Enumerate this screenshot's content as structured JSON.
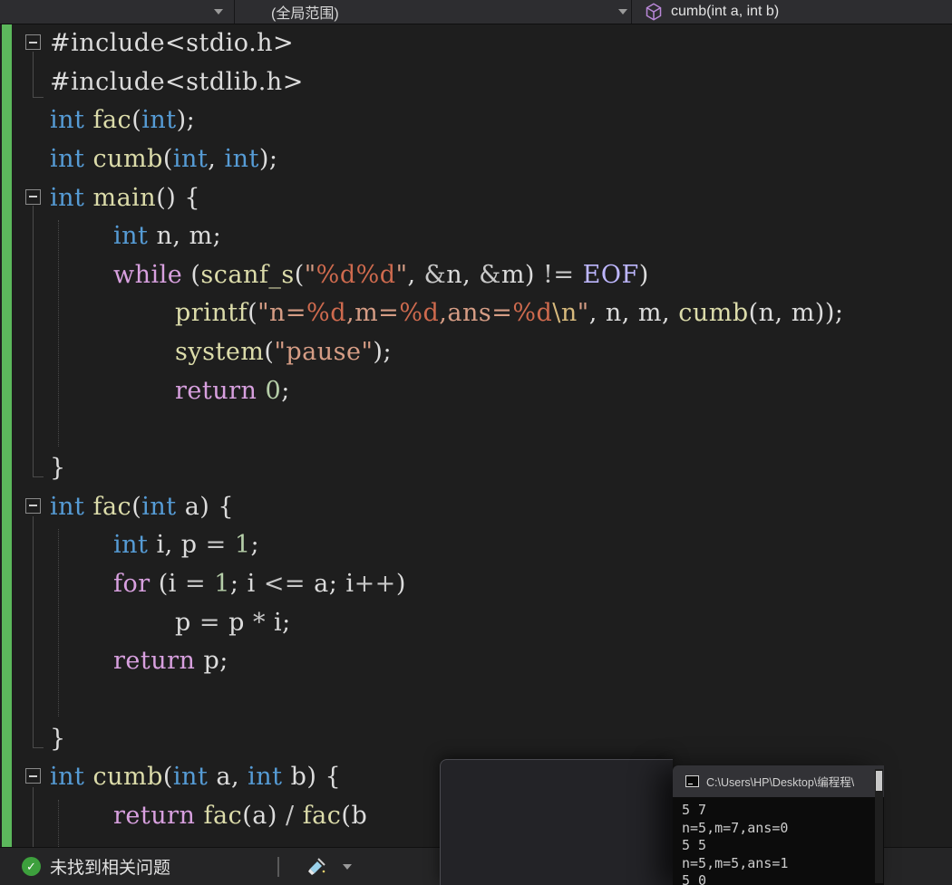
{
  "topbar": {
    "dropdown1": {
      "value": ""
    },
    "dropdown2": {
      "value": "(全局范围)"
    },
    "member": {
      "label": "cumb(int a, int b)",
      "icon": "cube-icon",
      "icon_color": "#B987D7"
    }
  },
  "editor": {
    "change_bar_color": "#5cb85c",
    "background": "#1e1e1e",
    "code_lines": [
      {
        "ind": 0,
        "fold": true,
        "segs": [
          {
            "t": "#include<stdio.h>",
            "c": "d"
          }
        ]
      },
      {
        "ind": 0,
        "fold": false,
        "segs": [
          {
            "t": "#include<stdlib.h>",
            "c": "d"
          }
        ]
      },
      {
        "ind": 0,
        "segs": [
          {
            "t": "int",
            "c": "kw"
          },
          {
            "t": " ",
            "c": "d"
          },
          {
            "t": "fac",
            "c": "fn"
          },
          {
            "t": "(",
            "c": "d"
          },
          {
            "t": "int",
            "c": "kw"
          },
          {
            "t": ");",
            "c": "d"
          }
        ]
      },
      {
        "ind": 0,
        "segs": [
          {
            "t": "int",
            "c": "kw"
          },
          {
            "t": " ",
            "c": "d"
          },
          {
            "t": "cumb",
            "c": "fn"
          },
          {
            "t": "(",
            "c": "d"
          },
          {
            "t": "int",
            "c": "kw"
          },
          {
            "t": ", ",
            "c": "d"
          },
          {
            "t": "int",
            "c": "kw"
          },
          {
            "t": ");",
            "c": "d"
          }
        ]
      },
      {
        "ind": 0,
        "fold": true,
        "segs": [
          {
            "t": "int",
            "c": "kw"
          },
          {
            "t": " ",
            "c": "d"
          },
          {
            "t": "main",
            "c": "fn"
          },
          {
            "t": "() {",
            "c": "d"
          }
        ]
      },
      {
        "ind": 1,
        "segs": [
          {
            "t": "int",
            "c": "kw"
          },
          {
            "t": " n, m;",
            "c": "d"
          }
        ]
      },
      {
        "ind": 1,
        "segs": [
          {
            "t": "while",
            "c": "ctrl"
          },
          {
            "t": " (",
            "c": "d"
          },
          {
            "t": "scanf_s",
            "c": "fn"
          },
          {
            "t": "(",
            "c": "d"
          },
          {
            "t": "\"",
            "c": "str"
          },
          {
            "t": "%d",
            "c": "fmt"
          },
          {
            "t": "%d",
            "c": "fmt"
          },
          {
            "t": "\"",
            "c": "str"
          },
          {
            "t": ", ",
            "c": "d"
          },
          {
            "t": "&",
            "c": "op"
          },
          {
            "t": "n, ",
            "c": "d"
          },
          {
            "t": "&",
            "c": "op"
          },
          {
            "t": "m) ",
            "c": "d"
          },
          {
            "t": "!=",
            "c": "op"
          },
          {
            "t": " ",
            "c": "d"
          },
          {
            "t": "EOF",
            "c": "mac"
          },
          {
            "t": ")",
            "c": "d"
          }
        ]
      },
      {
        "ind": 2,
        "segs": [
          {
            "t": "printf",
            "c": "fn"
          },
          {
            "t": "(",
            "c": "d"
          },
          {
            "t": "\"n=",
            "c": "str"
          },
          {
            "t": "%d",
            "c": "fmt"
          },
          {
            "t": ",m=",
            "c": "str"
          },
          {
            "t": "%d",
            "c": "fmt"
          },
          {
            "t": ",ans=",
            "c": "str"
          },
          {
            "t": "%d",
            "c": "fmt"
          },
          {
            "t": "\\n",
            "c": "esc"
          },
          {
            "t": "\"",
            "c": "str"
          },
          {
            "t": ", n, m, ",
            "c": "d"
          },
          {
            "t": "cumb",
            "c": "fn"
          },
          {
            "t": "(n, m));",
            "c": "d"
          }
        ]
      },
      {
        "ind": 2,
        "segs": [
          {
            "t": "system",
            "c": "fn"
          },
          {
            "t": "(",
            "c": "d"
          },
          {
            "t": "\"pause\"",
            "c": "str"
          },
          {
            "t": ");",
            "c": "d"
          }
        ]
      },
      {
        "ind": 2,
        "segs": [
          {
            "t": "return",
            "c": "ctrl"
          },
          {
            "t": " ",
            "c": "d"
          },
          {
            "t": "0",
            "c": "num"
          },
          {
            "t": ";",
            "c": "d"
          }
        ]
      },
      {
        "ind": 0,
        "segs": []
      },
      {
        "ind": 0,
        "segs": [
          {
            "t": "}",
            "c": "d"
          }
        ]
      },
      {
        "ind": 0,
        "fold": true,
        "segs": [
          {
            "t": "int",
            "c": "kw"
          },
          {
            "t": " ",
            "c": "d"
          },
          {
            "t": "fac",
            "c": "fn"
          },
          {
            "t": "(",
            "c": "d"
          },
          {
            "t": "int",
            "c": "kw"
          },
          {
            "t": " a) {",
            "c": "d"
          }
        ]
      },
      {
        "ind": 1,
        "segs": [
          {
            "t": "int",
            "c": "kw"
          },
          {
            "t": " i, p ",
            "c": "d"
          },
          {
            "t": "=",
            "c": "op"
          },
          {
            "t": " ",
            "c": "d"
          },
          {
            "t": "1",
            "c": "num"
          },
          {
            "t": ";",
            "c": "d"
          }
        ]
      },
      {
        "ind": 1,
        "segs": [
          {
            "t": "for",
            "c": "ctrl"
          },
          {
            "t": " (i ",
            "c": "d"
          },
          {
            "t": "=",
            "c": "op"
          },
          {
            "t": " ",
            "c": "d"
          },
          {
            "t": "1",
            "c": "num"
          },
          {
            "t": "; i ",
            "c": "d"
          },
          {
            "t": "<=",
            "c": "op"
          },
          {
            "t": " a; i",
            "c": "d"
          },
          {
            "t": "++",
            "c": "op"
          },
          {
            "t": ")",
            "c": "d"
          }
        ]
      },
      {
        "ind": 2,
        "segs": [
          {
            "t": "p ",
            "c": "d"
          },
          {
            "t": "=",
            "c": "op"
          },
          {
            "t": " p ",
            "c": "d"
          },
          {
            "t": "*",
            "c": "op"
          },
          {
            "t": " i;",
            "c": "d"
          }
        ]
      },
      {
        "ind": 1,
        "segs": [
          {
            "t": "return",
            "c": "ctrl"
          },
          {
            "t": " p;",
            "c": "d"
          }
        ]
      },
      {
        "ind": 0,
        "segs": []
      },
      {
        "ind": 0,
        "segs": [
          {
            "t": "}",
            "c": "d"
          }
        ]
      },
      {
        "ind": 0,
        "fold": true,
        "segs": [
          {
            "t": "int",
            "c": "kw"
          },
          {
            "t": " ",
            "c": "d"
          },
          {
            "t": "cumb",
            "c": "fn"
          },
          {
            "t": "(",
            "c": "d"
          },
          {
            "t": "int",
            "c": "kw"
          },
          {
            "t": " a, ",
            "c": "d"
          },
          {
            "t": "int",
            "c": "kw"
          },
          {
            "t": " b) {",
            "c": "d"
          }
        ]
      },
      {
        "ind": 1,
        "segs": [
          {
            "t": "return",
            "c": "ctrl"
          },
          {
            "t": " ",
            "c": "d"
          },
          {
            "t": "fac",
            "c": "fn"
          },
          {
            "t": "(a) ",
            "c": "d"
          },
          {
            "t": "/",
            "c": "op"
          },
          {
            "t": " ",
            "c": "d"
          },
          {
            "t": "fac",
            "c": "fn"
          },
          {
            "t": "(b",
            "c": "d"
          }
        ]
      }
    ]
  },
  "statusbar": {
    "message": "未找到相关问题",
    "check_color": "#3da03d"
  },
  "console": {
    "title": "C:\\Users\\HP\\Desktop\\编程程\\",
    "lines": [
      "5 7",
      "n=5,m=7,ans=0",
      "5 5",
      "n=5,m=5,ans=1",
      "5 0"
    ]
  }
}
